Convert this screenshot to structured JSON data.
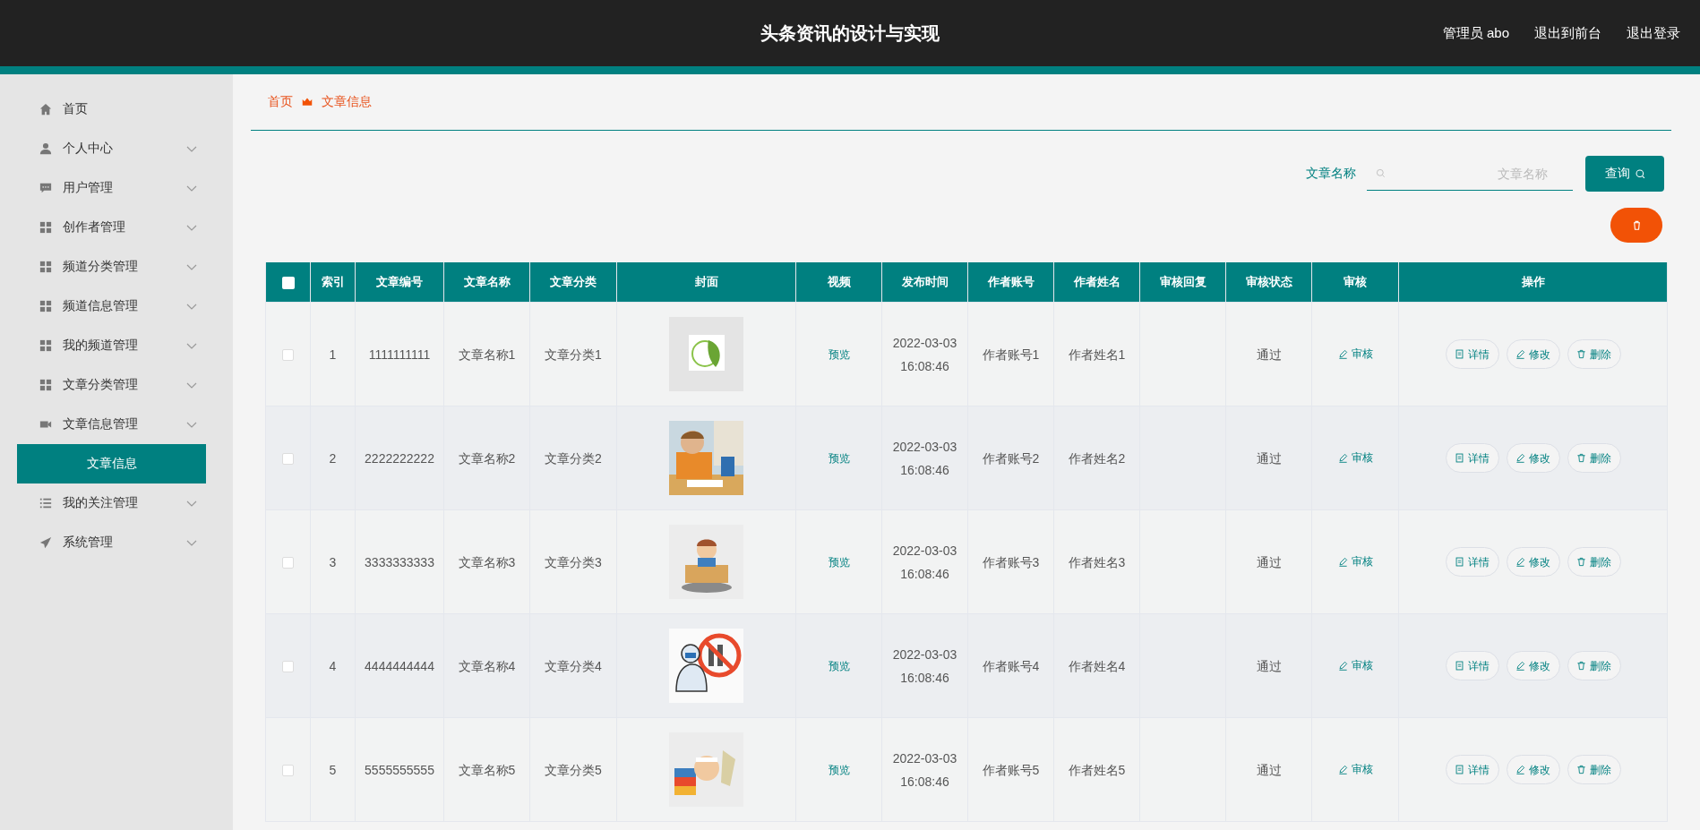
{
  "header": {
    "title": "头条资讯的设计与实现",
    "links": [
      "管理员 abo",
      "退出到前台",
      "退出登录"
    ]
  },
  "sidebar": {
    "items": [
      {
        "label": "首页",
        "expandable": false
      },
      {
        "label": "个人中心",
        "expandable": true
      },
      {
        "label": "用户管理",
        "expandable": true
      },
      {
        "label": "创作者管理",
        "expandable": true
      },
      {
        "label": "频道分类管理",
        "expandable": true
      },
      {
        "label": "频道信息管理",
        "expandable": true
      },
      {
        "label": "我的频道管理",
        "expandable": true
      },
      {
        "label": "文章分类管理",
        "expandable": true
      },
      {
        "label": "文章信息管理",
        "expandable": true,
        "expanded": true,
        "children": [
          {
            "label": "文章信息",
            "selected": true
          }
        ]
      },
      {
        "label": "我的关注管理",
        "expandable": true
      },
      {
        "label": "系统管理",
        "expandable": true
      }
    ]
  },
  "breadcrumb": [
    "首页",
    "文章信息"
  ],
  "search": {
    "label": "文章名称",
    "placeholder": "文章名称",
    "button": "查询"
  },
  "table": {
    "select_all_checked": false,
    "columns": [
      "索引",
      "文章编号",
      "文章名称",
      "文章分类",
      "封面",
      "视频",
      "发布时间",
      "作者账号",
      "作者姓名",
      "审核回复",
      "审核状态",
      "审核",
      "操作"
    ],
    "rows": [
      {
        "checked": false,
        "index": "1",
        "number": "1111111111",
        "name": "文章名称1",
        "category": "文章分类1",
        "video": "预览",
        "time": "2022-03-03 16:08:46",
        "account": "作者账号1",
        "author": "作者姓名1",
        "status": "通过",
        "review": "审核",
        "actions": [
          "详情",
          "修改",
          "删除"
        ]
      },
      {
        "checked": false,
        "index": "2",
        "number": "2222222222",
        "name": "文章名称2",
        "category": "文章分类2",
        "video": "预览",
        "time": "2022-03-03 16:08:46",
        "account": "作者账号2",
        "author": "作者姓名2",
        "status": "通过",
        "review": "审核",
        "actions": [
          "详情",
          "修改",
          "删除"
        ]
      },
      {
        "checked": false,
        "index": "3",
        "number": "3333333333",
        "name": "文章名称3",
        "category": "文章分类3",
        "video": "预览",
        "time": "2022-03-03 16:08:46",
        "account": "作者账号3",
        "author": "作者姓名3",
        "status": "通过",
        "review": "审核",
        "actions": [
          "详情",
          "修改",
          "删除"
        ]
      },
      {
        "checked": false,
        "index": "4",
        "number": "4444444444",
        "name": "文章名称4",
        "category": "文章分类4",
        "video": "预览",
        "time": "2022-03-03 16:08:46",
        "account": "作者账号4",
        "author": "作者姓名4",
        "status": "通过",
        "review": "审核",
        "actions": [
          "详情",
          "修改",
          "删除"
        ]
      },
      {
        "checked": false,
        "index": "5",
        "number": "5555555555",
        "name": "文章名称5",
        "category": "文章分类5",
        "video": "预览",
        "time": "2022-03-03 16:08:46",
        "account": "作者账号5",
        "author": "作者姓名5",
        "status": "通过",
        "review": "审核",
        "actions": [
          "详情",
          "修改",
          "删除"
        ]
      }
    ]
  }
}
